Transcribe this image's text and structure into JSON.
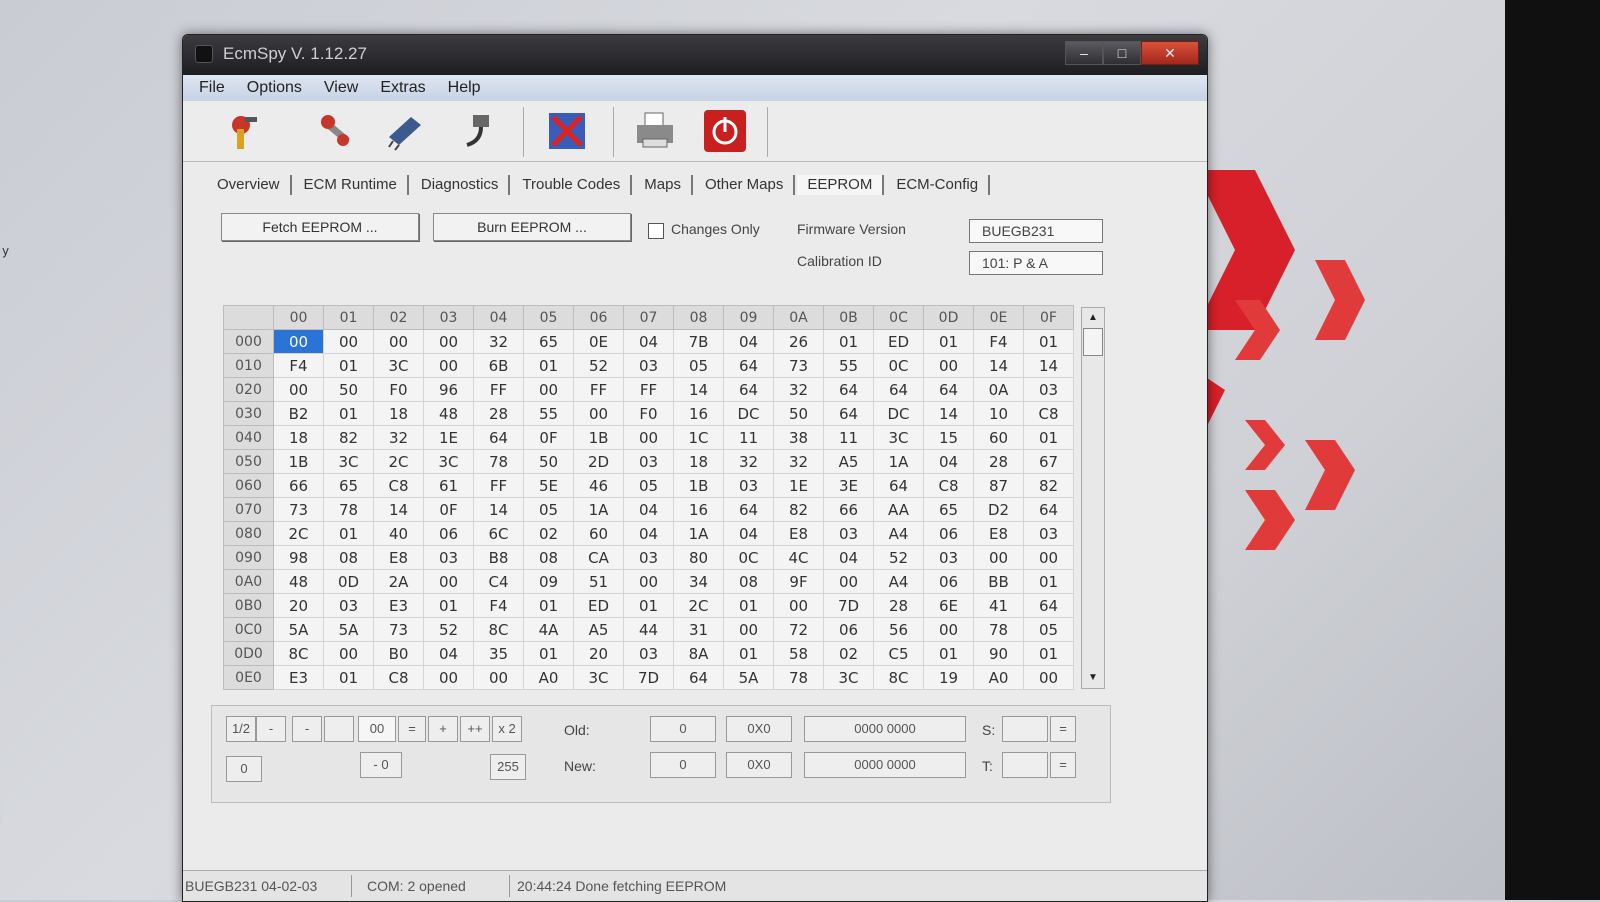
{
  "window": {
    "title": "EcmSpy V. 1.12.27",
    "controls": [
      "–",
      "□",
      "✕"
    ]
  },
  "menu": [
    "File",
    "Options",
    "View",
    "Extras",
    "Help"
  ],
  "toolbar": [
    "connect-icon",
    "tools-icon",
    "chip-icon",
    "cable-icon",
    "cancel-icon",
    "print-icon",
    "power-icon"
  ],
  "tabs": [
    "Overview",
    "ECM Runtime",
    "Diagnostics",
    "Trouble Codes",
    "Maps",
    "Other Maps",
    "EEPROM",
    "ECM-Config"
  ],
  "active_tab": "EEPROM",
  "eeprom": {
    "fetch_button": "Fetch EEPROM ...",
    "burn_button": "Burn EEPROM ...",
    "changes_only_label": "Changes Only",
    "firmware_label": "Firmware Version",
    "firmware_value": "BUEGB231",
    "calibration_label": "Calibration ID",
    "calibration_value": "101: P & A"
  },
  "hex": {
    "columns": [
      "00",
      "01",
      "02",
      "03",
      "04",
      "05",
      "06",
      "07",
      "08",
      "09",
      "0A",
      "0B",
      "0C",
      "0D",
      "0E",
      "0F"
    ],
    "rows": [
      {
        "addr": "000",
        "cells": [
          "00",
          "00",
          "00",
          "00",
          "32",
          "65",
          "0E",
          "04",
          "7B",
          "04",
          "26",
          "01",
          "ED",
          "01",
          "F4",
          "01"
        ]
      },
      {
        "addr": "010",
        "cells": [
          "F4",
          "01",
          "3C",
          "00",
          "6B",
          "01",
          "52",
          "03",
          "05",
          "64",
          "73",
          "55",
          "0C",
          "00",
          "14",
          "14"
        ]
      },
      {
        "addr": "020",
        "cells": [
          "00",
          "50",
          "F0",
          "96",
          "FF",
          "00",
          "FF",
          "FF",
          "14",
          "64",
          "32",
          "64",
          "64",
          "64",
          "0A",
          "03"
        ]
      },
      {
        "addr": "030",
        "cells": [
          "B2",
          "01",
          "18",
          "48",
          "28",
          "55",
          "00",
          "F0",
          "16",
          "DC",
          "50",
          "64",
          "DC",
          "14",
          "10",
          "C8"
        ]
      },
      {
        "addr": "040",
        "cells": [
          "18",
          "82",
          "32",
          "1E",
          "64",
          "0F",
          "1B",
          "00",
          "1C",
          "11",
          "38",
          "11",
          "3C",
          "15",
          "60",
          "01"
        ]
      },
      {
        "addr": "050",
        "cells": [
          "1B",
          "3C",
          "2C",
          "3C",
          "78",
          "50",
          "2D",
          "03",
          "18",
          "32",
          "32",
          "A5",
          "1A",
          "04",
          "28",
          "67"
        ]
      },
      {
        "addr": "060",
        "cells": [
          "66",
          "65",
          "C8",
          "61",
          "FF",
          "5E",
          "46",
          "05",
          "1B",
          "03",
          "1E",
          "3E",
          "64",
          "C8",
          "87",
          "82"
        ]
      },
      {
        "addr": "070",
        "cells": [
          "73",
          "78",
          "14",
          "0F",
          "14",
          "05",
          "1A",
          "04",
          "16",
          "64",
          "82",
          "66",
          "AA",
          "65",
          "D2",
          "64"
        ]
      },
      {
        "addr": "080",
        "cells": [
          "2C",
          "01",
          "40",
          "06",
          "6C",
          "02",
          "60",
          "04",
          "1A",
          "04",
          "E8",
          "03",
          "A4",
          "06",
          "E8",
          "03"
        ]
      },
      {
        "addr": "090",
        "cells": [
          "98",
          "08",
          "E8",
          "03",
          "B8",
          "08",
          "CA",
          "03",
          "80",
          "0C",
          "4C",
          "04",
          "52",
          "03",
          "00",
          "00"
        ]
      },
      {
        "addr": "0A0",
        "cells": [
          "48",
          "0D",
          "2A",
          "00",
          "C4",
          "09",
          "51",
          "00",
          "34",
          "08",
          "9F",
          "00",
          "A4",
          "06",
          "BB",
          "01"
        ]
      },
      {
        "addr": "0B0",
        "cells": [
          "20",
          "03",
          "E3",
          "01",
          "F4",
          "01",
          "ED",
          "01",
          "2C",
          "01",
          "00",
          "7D",
          "28",
          "6E",
          "41",
          "64"
        ]
      },
      {
        "addr": "0C0",
        "cells": [
          "5A",
          "5A",
          "73",
          "52",
          "8C",
          "4A",
          "A5",
          "44",
          "31",
          "00",
          "72",
          "06",
          "56",
          "00",
          "78",
          "05"
        ]
      },
      {
        "addr": "0D0",
        "cells": [
          "8C",
          "00",
          "B0",
          "04",
          "35",
          "01",
          "20",
          "03",
          "8A",
          "01",
          "58",
          "02",
          "C5",
          "01",
          "90",
          "01"
        ]
      },
      {
        "addr": "0E0",
        "cells": [
          "E3",
          "01",
          "C8",
          "00",
          "00",
          "A0",
          "3C",
          "7D",
          "64",
          "5A",
          "78",
          "3C",
          "8C",
          "19",
          "A0",
          "00"
        ]
      }
    ]
  },
  "edit": {
    "buttons": [
      "1/2",
      "-",
      "-",
      "",
      "=",
      "+",
      "++",
      "x 2"
    ],
    "value": "00",
    "range_min": "0",
    "range_max": "255",
    "range_mid": "- 0",
    "old_label": "Old:",
    "new_label": "New:",
    "old_dec": "0",
    "old_hex": "0X0",
    "old_bin": "0000 0000",
    "new_dec": "0",
    "new_hex": "0X0",
    "new_bin": "0000 0000",
    "s_label": "S:",
    "t_label": "T:",
    "eq": "="
  },
  "status": {
    "left": "BUEGB231 04-02-03",
    "com": "COM: 2 opened",
    "message": "20:44:24 Done fetching EEPROM"
  },
  "desktop_text": "y"
}
